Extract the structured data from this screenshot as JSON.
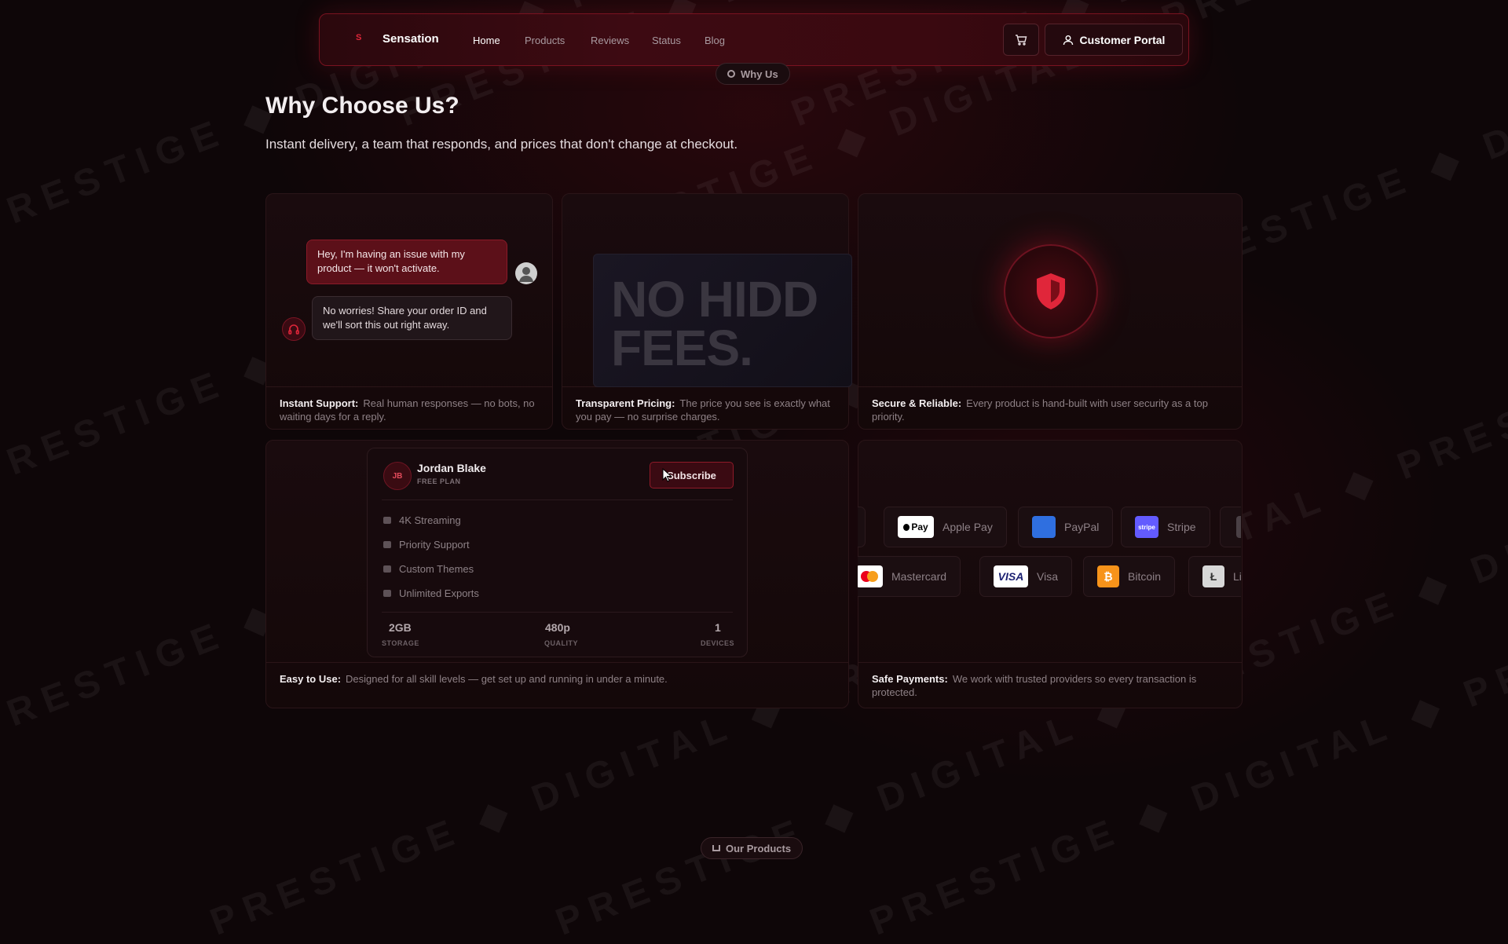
{
  "nav": {
    "logo_mark": "S",
    "brand": "Sensation",
    "links": [
      "Home",
      "Products",
      "Reviews",
      "Status",
      "Blog"
    ],
    "active": "Home",
    "cart_icon": "cart-icon",
    "portal_label": "Customer Portal"
  },
  "section_pill": "Why Us",
  "heading": "Why Choose Us?",
  "subheading": "Instant delivery, a team that responds, and prices that don't change at checkout.",
  "cards": {
    "support": {
      "user_message": "Hey, I'm having an issue with my product — it won't activate.",
      "agent_message": "No worries! Share your order ID and we'll sort this out right away.",
      "title": "Instant Support:",
      "text": "Real human responses — no bots, no waiting days for a reply."
    },
    "pricing": {
      "fees_text": "NO HIDD\nFEES.",
      "title": "Transparent Pricing:",
      "text": "The price you see is exactly what you pay — no surprise charges."
    },
    "secure": {
      "title": "Secure & Reliable:",
      "text": "Every product is hand-built with user security as a top priority."
    },
    "easy": {
      "user_initials": "JB",
      "user_name": "Jordan Blake",
      "plan": "FREE PLAN",
      "subscribe_label": "Subscribe",
      "features": [
        "4K Streaming",
        "Priority Support",
        "Custom Themes",
        "Unlimited Exports"
      ],
      "stats": [
        {
          "value": "2GB",
          "label": "STORAGE"
        },
        {
          "value": "480p",
          "label": "QUALITY"
        },
        {
          "value": "1",
          "label": "DEVICES"
        }
      ],
      "title": "Easy to Use:",
      "text": "Designed for all skill levels — get set up and running in under a minute."
    },
    "payments": {
      "row1": [
        "Apple Pay",
        "PayPal",
        "Stripe"
      ],
      "row2": [
        "Mastercard",
        "Visa",
        "Bitcoin",
        "Li"
      ],
      "apple_logo": "Pay",
      "stripe_logo": "stripe",
      "visa_logo": "VISA",
      "bitcoin_logo": "₿",
      "litecoin_logo": "Ł",
      "title": "Safe Payments:",
      "text": "We work with trusted providers so every transaction is protected."
    }
  },
  "next_section_pill": "Our Products",
  "watermark": "PRESTIGE ◆ DIGITAL ◆",
  "colors": {
    "accent": "#e0263a",
    "background": "#0e0608"
  }
}
